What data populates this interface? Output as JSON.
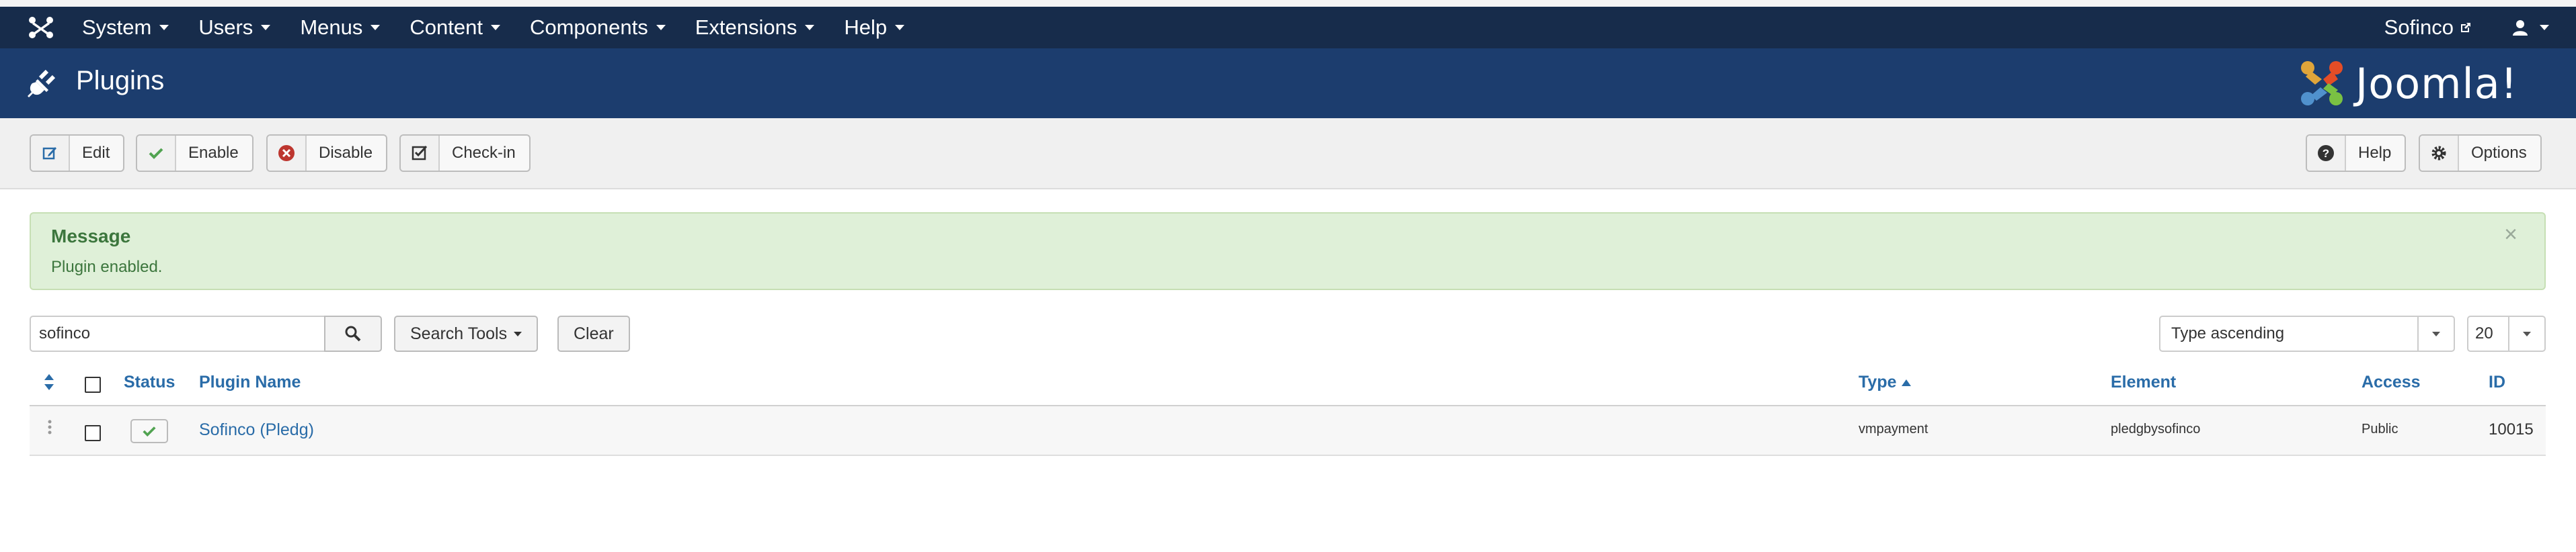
{
  "nav": {
    "menu": [
      {
        "label": "System"
      },
      {
        "label": "Users"
      },
      {
        "label": "Menus"
      },
      {
        "label": "Content"
      },
      {
        "label": "Components"
      },
      {
        "label": "Extensions"
      },
      {
        "label": "Help"
      }
    ],
    "site_name": "Sofinco"
  },
  "header": {
    "title": "Plugins",
    "brand": "Joomla!"
  },
  "toolbar": {
    "edit": "Edit",
    "enable": "Enable",
    "disable": "Disable",
    "checkin": "Check-in",
    "help": "Help",
    "options": "Options"
  },
  "message": {
    "heading": "Message",
    "body": "Plugin enabled.",
    "close": "×"
  },
  "filters": {
    "search_value": "sofinco",
    "search_tools": "Search Tools",
    "clear": "Clear",
    "ordering": "Type ascending",
    "limit": "20"
  },
  "table": {
    "headers": {
      "status": "Status",
      "name": "Plugin Name",
      "type": "Type",
      "element": "Element",
      "access": "Access",
      "id": "ID"
    },
    "rows": [
      {
        "name": "Sofinco (Pledg)",
        "type": "vmpayment",
        "element": "pledgbysofinco",
        "access": "Public",
        "id": "10015",
        "status": "enabled"
      }
    ]
  },
  "colors": {
    "navbar": "#172c4b",
    "header": "#1c3d6e",
    "link": "#2a6ca8",
    "success_bg": "#dff0d8",
    "success_text": "#3c763d"
  }
}
